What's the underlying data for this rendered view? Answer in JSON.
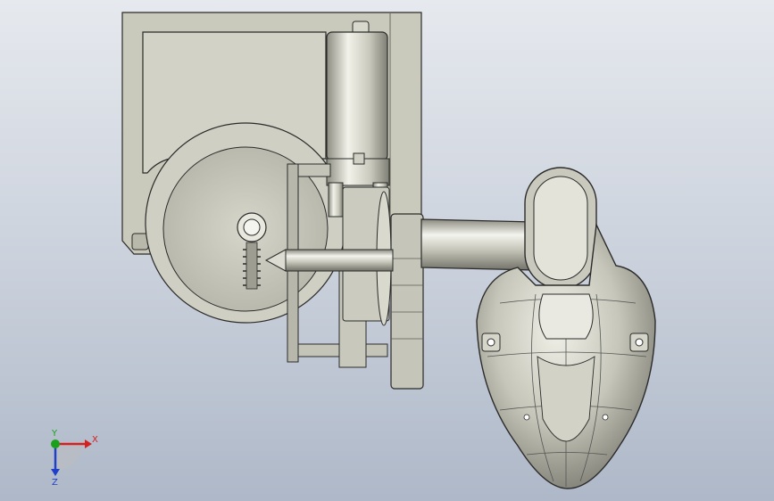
{
  "viewport": {
    "background_top": "#e6e9ee",
    "background_bottom": "#aeb8c8"
  },
  "model": {
    "plate_color": "#c9c9bc",
    "metal_color": "#bdbdb0",
    "outline_color": "#2b2b2b"
  },
  "triad": {
    "x_label": "X",
    "y_label": "Y",
    "z_label": "Z",
    "x_color": "#d42020",
    "y_color": "#1aa01a",
    "z_color": "#1f3fc8"
  }
}
